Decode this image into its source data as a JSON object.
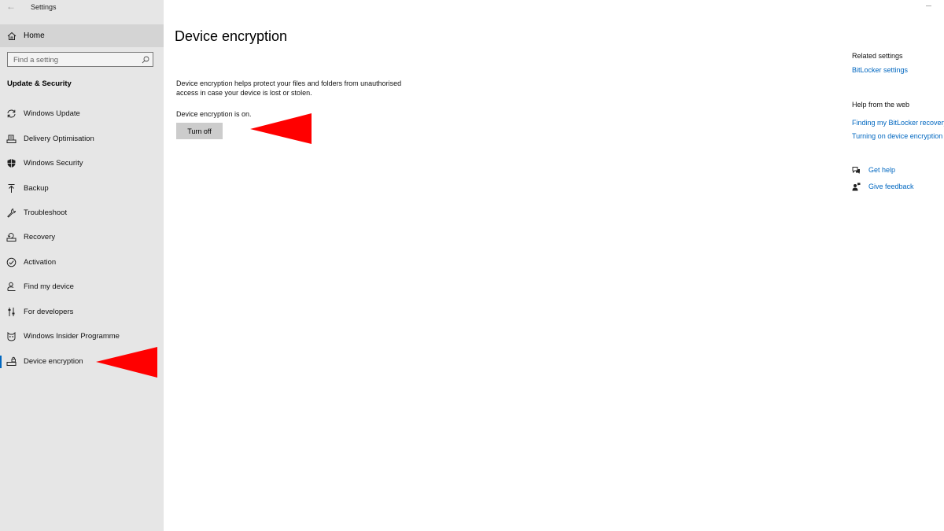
{
  "window": {
    "title": "Settings"
  },
  "sidebar": {
    "home_label": "Home",
    "search_placeholder": "Find a setting",
    "section_title": "Update & Security",
    "items": [
      {
        "label": "Windows Update",
        "icon": "refresh-icon"
      },
      {
        "label": "Delivery Optimisation",
        "icon": "delivery-icon"
      },
      {
        "label": "Windows Security",
        "icon": "shield-icon"
      },
      {
        "label": "Backup",
        "icon": "backup-arrow-icon"
      },
      {
        "label": "Troubleshoot",
        "icon": "wrench-icon"
      },
      {
        "label": "Recovery",
        "icon": "recovery-icon"
      },
      {
        "label": "Activation",
        "icon": "check-circle-icon"
      },
      {
        "label": "Find my device",
        "icon": "person-pin-icon"
      },
      {
        "label": "For developers",
        "icon": "developer-icon"
      },
      {
        "label": "Windows Insider Programme",
        "icon": "insider-cat-icon"
      },
      {
        "label": "Device encryption",
        "icon": "drive-lock-icon",
        "selected": true
      }
    ]
  },
  "main": {
    "title": "Device encryption",
    "description": "Device encryption helps protect your files and folders from unauthorised access in case your device is lost or stolen.",
    "status": "Device encryption is on.",
    "button_label": "Turn off"
  },
  "related": {
    "heading": "Related settings",
    "link": "BitLocker settings",
    "help_heading": "Help from the web",
    "help_links": [
      "Finding my BitLocker recovery key",
      "Turning on device encryption"
    ],
    "get_help": "Get help",
    "give_feedback": "Give feedback"
  },
  "colors": {
    "accent": "#0067c0",
    "sidebar_bg": "#e6e6e6",
    "annotation": "#ff0000"
  }
}
